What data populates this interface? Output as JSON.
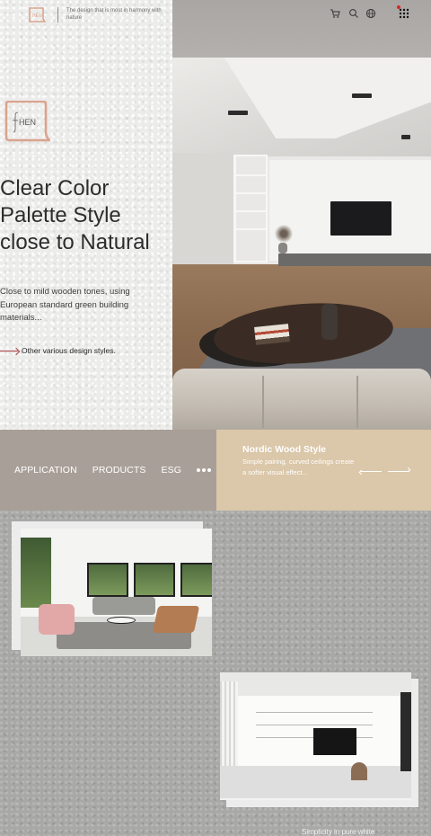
{
  "brand": {
    "tagline": "The design that is most in harmony with nature",
    "logo_text": "HEN"
  },
  "header_icons": [
    "cart-icon",
    "search-icon",
    "globe-icon",
    "grid-menu-icon"
  ],
  "hero": {
    "headline": "Clear Color Palette Style close to Natural",
    "description": "Close to mild wooden tones, using European standard green building materials...",
    "link_label": "Other various design styles."
  },
  "nav": {
    "items": [
      "APPLICATION",
      "PRODUCTS",
      "ESG"
    ]
  },
  "feature": {
    "title": "Nordic Wood Style",
    "description": "Simple pairing, curved ceilings create a softer visual effect..."
  },
  "gallery": {
    "caption": "Simplicity in pure white"
  },
  "colors": {
    "accent": "#b0454a",
    "logo": "#d9a48e",
    "nav_bg": "#a89f98",
    "feature_bg": "#dbc7a9",
    "alert_dot": "#d62828"
  }
}
